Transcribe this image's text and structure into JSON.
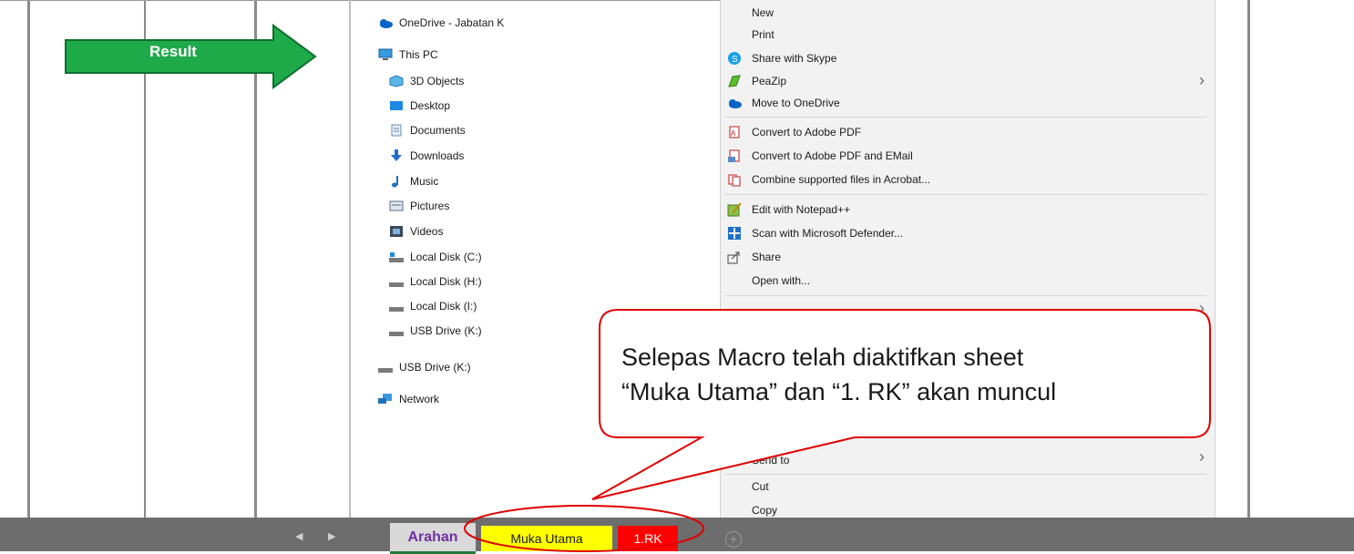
{
  "arrow": {
    "label": "Result",
    "fill": "#1faa4a"
  },
  "nav_pane": {
    "items": [
      {
        "label": "OneDrive - Jabatan K",
        "icon": "onedrive-cloud-icon"
      },
      {
        "label": "This PC",
        "icon": "monitor-icon"
      },
      {
        "label": "3D Objects",
        "icon": "3d-objects-icon"
      },
      {
        "label": "Desktop",
        "icon": "desktop-icon"
      },
      {
        "label": "Documents",
        "icon": "documents-icon"
      },
      {
        "label": "Downloads",
        "icon": "downloads-icon"
      },
      {
        "label": "Music",
        "icon": "music-icon"
      },
      {
        "label": "Pictures",
        "icon": "pictures-icon"
      },
      {
        "label": "Videos",
        "icon": "videos-icon"
      },
      {
        "label": "Local Disk (C:)",
        "icon": "drive-c-icon"
      },
      {
        "label": "Local Disk (H:)",
        "icon": "drive-icon"
      },
      {
        "label": "Local Disk (I:)",
        "icon": "drive-icon"
      },
      {
        "label": "USB Drive (K:)",
        "icon": "usb-drive-icon"
      },
      {
        "label": "USB Drive (K:)",
        "icon": "usb-drive-icon"
      },
      {
        "label": "Network",
        "icon": "network-icon"
      }
    ]
  },
  "context_menu": {
    "items": [
      {
        "label": "New"
      },
      {
        "label": "Print"
      },
      {
        "label": "Share with Skype",
        "icon": "skype-icon"
      },
      {
        "label": "PeaZip",
        "icon": "peazip-icon"
      },
      {
        "label": "Move to OneDrive",
        "icon": "onedrive-icon"
      },
      {
        "label": "Convert to Adobe PDF",
        "icon": "adobe-pdf-icon"
      },
      {
        "label": "Convert to Adobe PDF and EMail",
        "icon": "adobe-pdf-email-icon"
      },
      {
        "label": "Combine supported files in Acrobat...",
        "icon": "acrobat-combine-icon"
      },
      {
        "label": "Edit with Notepad++",
        "icon": "notepad-plus-icon"
      },
      {
        "label": "Scan with Microsoft Defender...",
        "icon": "defender-icon"
      },
      {
        "label": "Share",
        "icon": "share-icon"
      },
      {
        "label": "Open with..."
      },
      {
        "label": "Send to"
      },
      {
        "label": "Cut"
      },
      {
        "label": "Copy"
      }
    ]
  },
  "callout": {
    "line1": "Selepas Macro telah diaktifkan sheet",
    "line2": "“Muka Utama” dan “1. RK” akan muncul"
  },
  "sheet_tabs": [
    {
      "label": "Arahan",
      "active": true,
      "color": "#d9d9d9"
    },
    {
      "label": "Muka Utama",
      "color": "#ffff00"
    },
    {
      "label": "1.RK",
      "color": "#ff0000"
    }
  ],
  "colors": {
    "highlight_ellipse": "#e00000",
    "callout_border": "#e00000"
  }
}
